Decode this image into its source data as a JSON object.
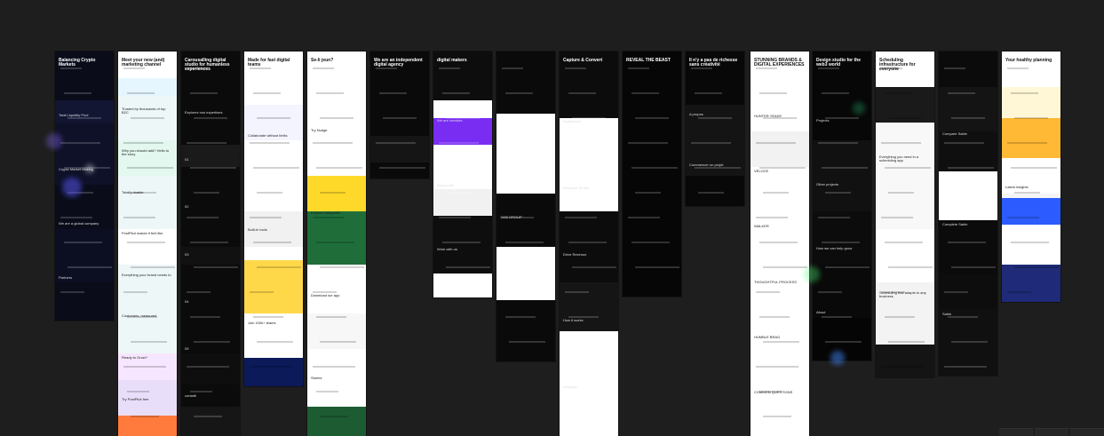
{
  "canvas": {
    "background": "#1e1e1e"
  },
  "frames": [
    {
      "name": "balancing-crypto-markets",
      "headline": "Balancing Crypto Markets",
      "texts": [
        "Total Liquidity Pool",
        "Crypto Market Making",
        "We are a global company",
        "Partners"
      ]
    },
    {
      "name": "marketing-channel",
      "headline": "Meet your new (and) marketing channel",
      "texts": [
        "Trusted by thousands of top B2C",
        "Why you should add? Hello to the story",
        "Totally doable",
        "PostPilot makes it feel like",
        "Everything your brand needs to",
        "Customers, measured",
        "Ready to Grow?",
        "Try PostPilot free"
      ]
    },
    {
      "name": "carousel-studio",
      "headline": "Carousalling digital studio for humanless experiences",
      "texts": [
        "Explorez nos expertises",
        "01",
        "02",
        "03",
        "04",
        "05",
        "contatti"
      ]
    },
    {
      "name": "tools-landing",
      "headline": "Made for fast digital teams",
      "texts": [
        "Collaborate without limits",
        "Built-in tools",
        "Join 100k+ teams"
      ]
    },
    {
      "name": "se-li-jeun",
      "headline": "Se-li jeun?",
      "texts": [
        "Try Nudge",
        "Explore categories",
        "Download our app",
        "Stories"
      ]
    },
    {
      "name": "dark-agency",
      "headline": "We are an independent digital agency",
      "texts": []
    },
    {
      "name": "digital-makers",
      "headline": "digital makers",
      "texts": [
        "We are creators",
        "ergonomie",
        "Work with us"
      ]
    },
    {
      "name": "dark-landing",
      "headline": "",
      "texts": [
        "1000 GROUP"
      ]
    },
    {
      "name": "capture-convert",
      "headline": "Capture & Convert",
      "texts": [
        "Experience",
        "Welcome Studio",
        "Drive Revenue",
        "How it works",
        "Integrate"
      ]
    },
    {
      "name": "reveal-the-beast",
      "headline": "REVEAL THE BEAST",
      "texts": []
    },
    {
      "name": "richesse-creative",
      "headline": "Il n'y a pas de richesse sans créativité",
      "texts": [
        "A propos",
        "Commencer un projet"
      ]
    },
    {
      "name": "stunning-brands",
      "headline": "STUNNING BRANDS & DIGITAL EXPERIENCES",
      "texts": [
        "HUNTER YEANY",
        "VELOCE",
        "WALKER",
        "THOUGHTFUL PROCESS",
        "HUMBLE BRAG",
        "COMMON QUESTIONS"
      ]
    },
    {
      "name": "design-studio-web3",
      "headline": "Design studio for the web3 world",
      "texts": [
        "Projects",
        "Other projects",
        "How we can help grow",
        "About"
      ]
    },
    {
      "name": "scheduling-infrastructure",
      "headline": "Scheduling infrastructure for everyone",
      "texts": [
        "Everything you need in a scheduling app",
        "Scheduling that adapts to any business"
      ]
    },
    {
      "name": "fintech-dark",
      "headline": "",
      "texts": [
        "Compare Sable",
        "Complete Sable",
        "Sable"
      ]
    },
    {
      "name": "healthy-planning",
      "headline": "Your healthy planning",
      "texts": [
        "Latest insights"
      ]
    }
  ]
}
